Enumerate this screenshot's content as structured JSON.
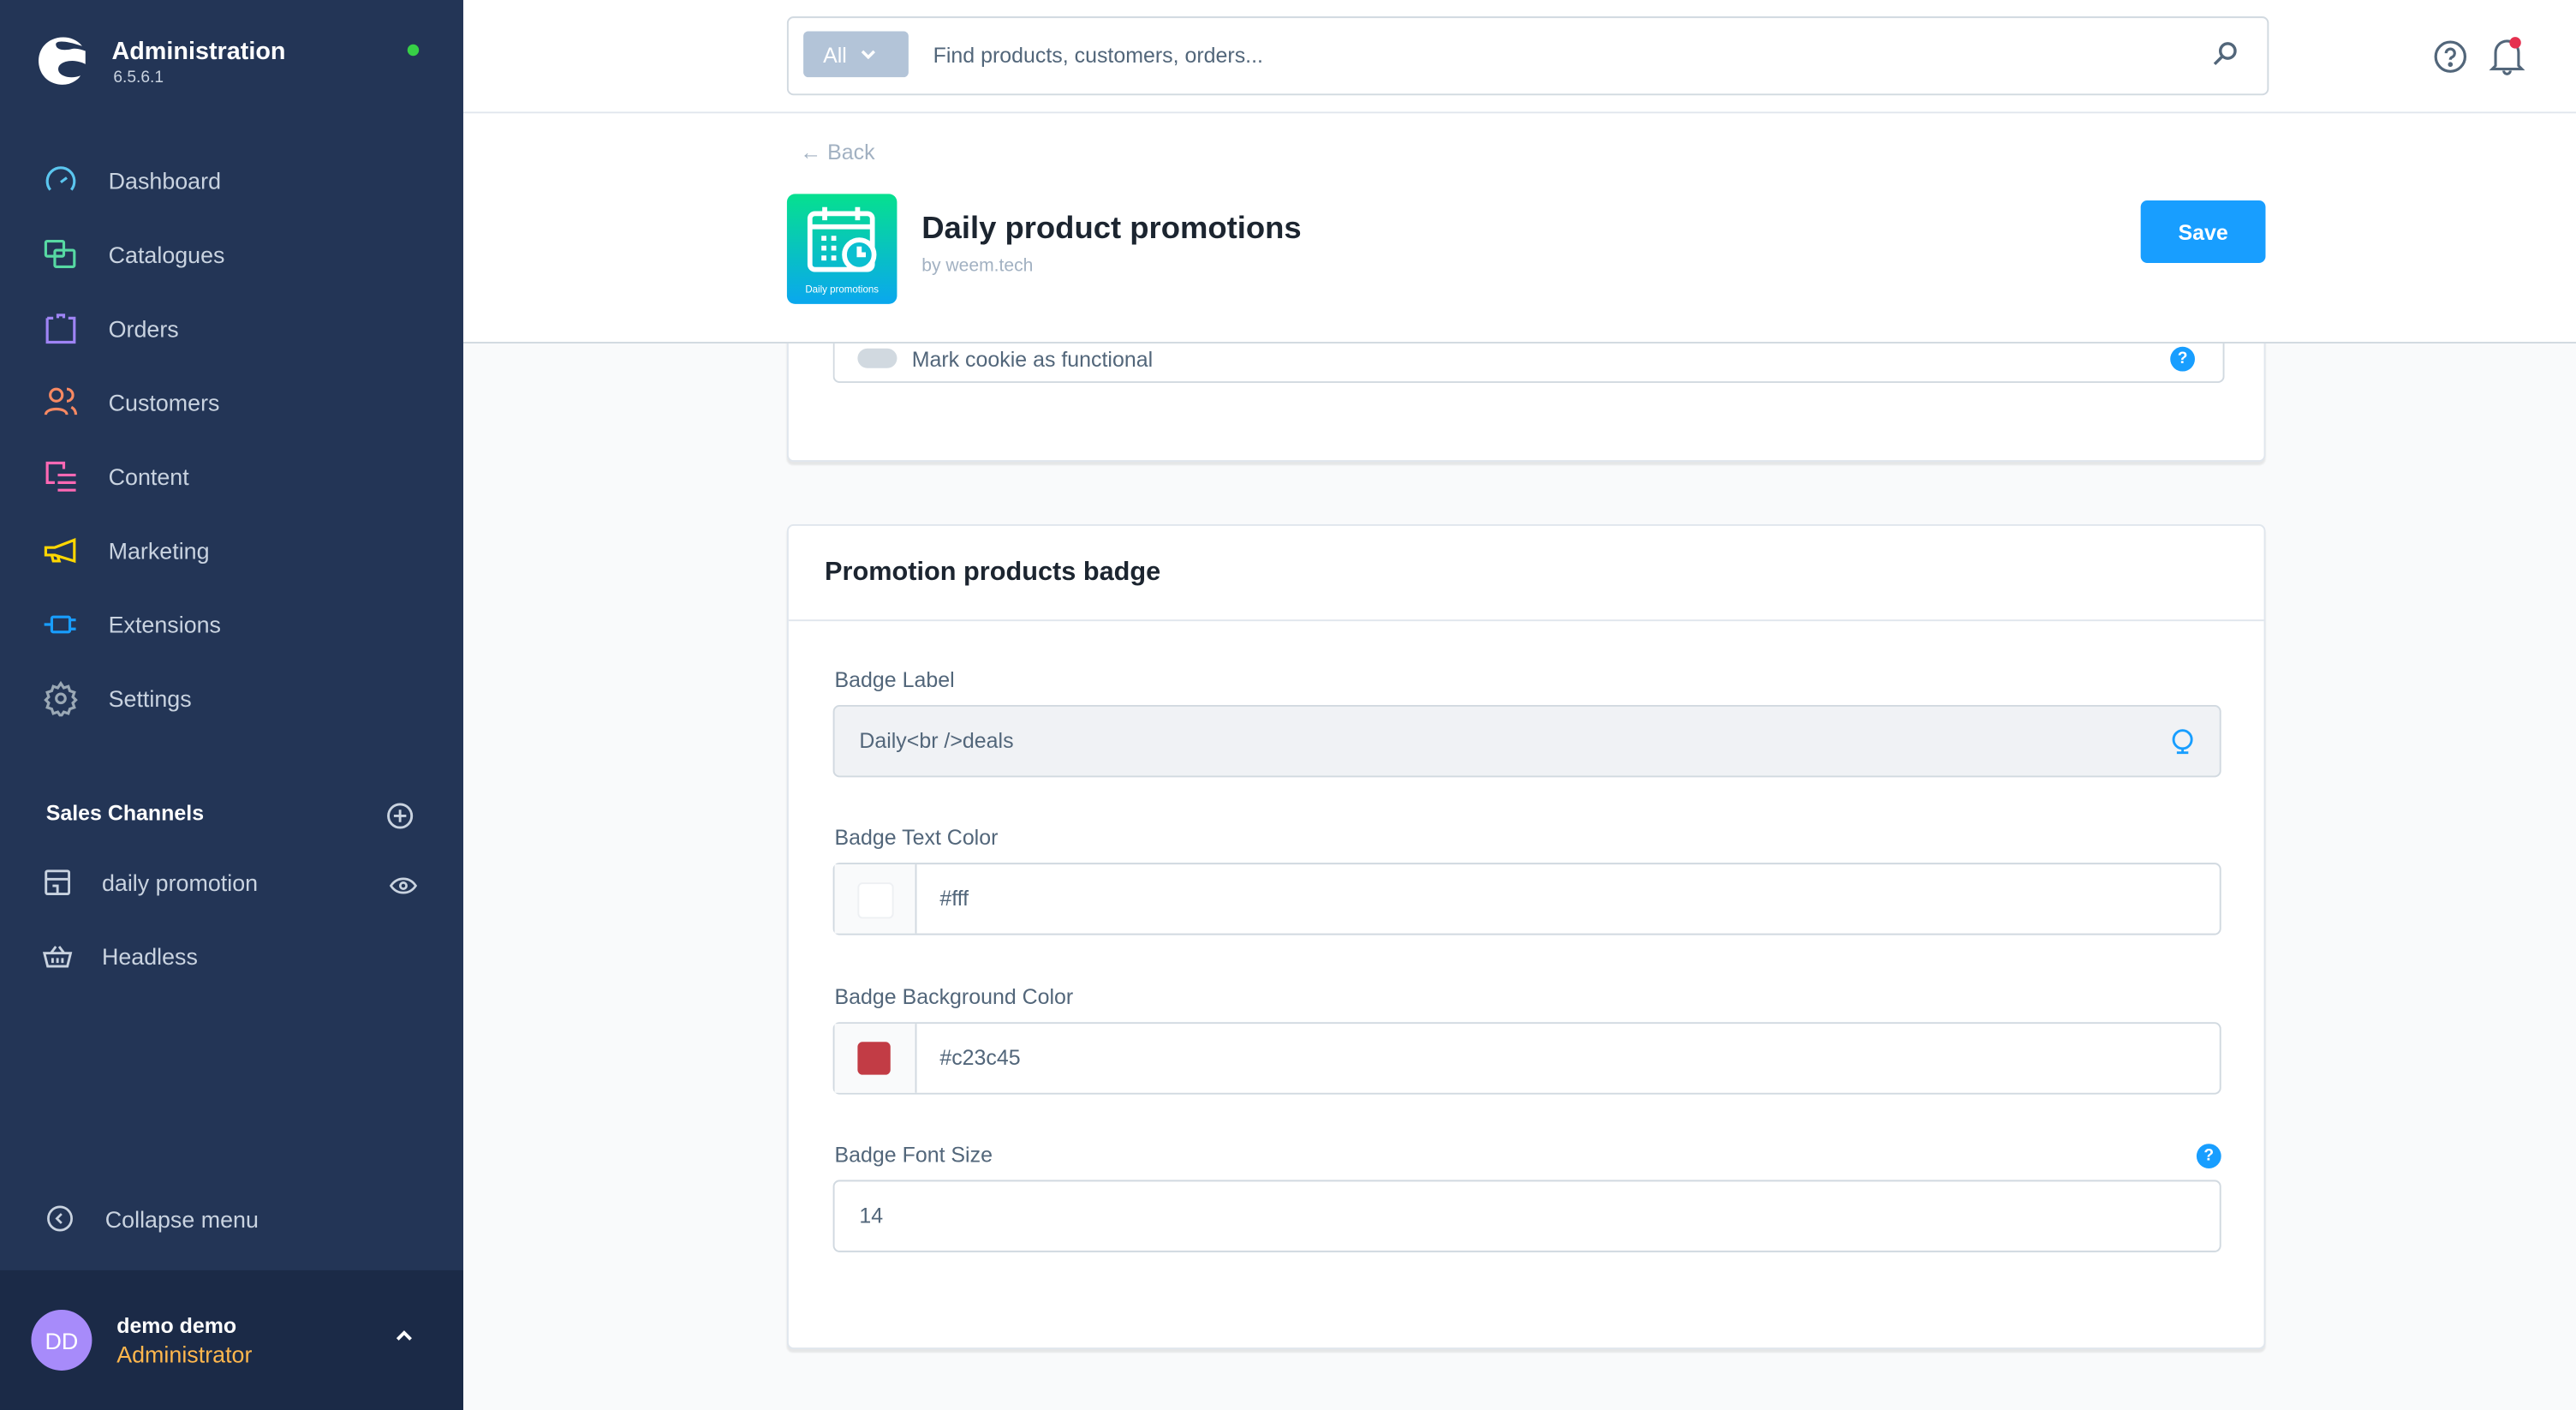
{
  "brand": {
    "title": "Administration",
    "version": "6.5.6.1"
  },
  "nav": [
    {
      "label": "Dashboard",
      "icon": "dashboard-icon",
      "color": "#5bc6ef"
    },
    {
      "label": "Catalogues",
      "icon": "catalogues-icon",
      "color": "#57d9a3"
    },
    {
      "label": "Orders",
      "icon": "orders-icon",
      "color": "#9f84f5"
    },
    {
      "label": "Customers",
      "icon": "customers-icon",
      "color": "#f88962"
    },
    {
      "label": "Content",
      "icon": "content-icon",
      "color": "#ff68b4"
    },
    {
      "label": "Marketing",
      "icon": "marketing-icon",
      "color": "#ffd700"
    },
    {
      "label": "Extensions",
      "icon": "extensions-icon",
      "color": "#189eff"
    },
    {
      "label": "Settings",
      "icon": "settings-icon",
      "color": "#9aa8b5"
    }
  ],
  "sales_channels": {
    "title": "Sales Channels",
    "items": [
      {
        "label": "daily promotion"
      },
      {
        "label": "Headless"
      }
    ]
  },
  "collapse_label": "Collapse menu",
  "user": {
    "initials": "DD",
    "name": "demo demo",
    "role": "Administrator"
  },
  "search": {
    "type": "All",
    "placeholder": "Find products, customers, orders..."
  },
  "header": {
    "back": "Back",
    "title": "Daily product promotions",
    "by": "by weem.tech",
    "icon_label": "Daily promotions",
    "save": "Save"
  },
  "prev_card": {
    "toggle_label": "Mark cookie as functional"
  },
  "badge_card": {
    "title": "Promotion products badge",
    "label_field": {
      "label": "Badge Label",
      "value": "Daily<br />deals"
    },
    "text_color": {
      "label": "Badge Text Color",
      "value": "#fff",
      "swatch": "#ffffff"
    },
    "bg_color": {
      "label": "Badge Background Color",
      "value": "#c23c45",
      "swatch": "#c23c45"
    },
    "font_size": {
      "label": "Badge Font Size",
      "value": "14"
    }
  }
}
